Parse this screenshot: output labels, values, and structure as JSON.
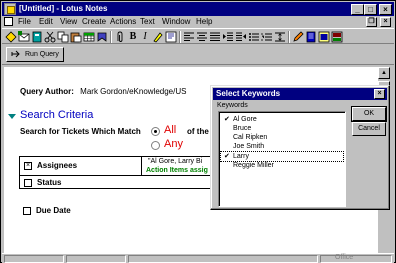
{
  "window": {
    "title": "[Untitled] - Lotus Notes",
    "min_glyph": "_",
    "max_glyph": "□",
    "close_glyph": "×"
  },
  "menu": {
    "items": [
      "File",
      "Edit",
      "View",
      "Create",
      "Actions",
      "Text",
      "Window",
      "Help"
    ],
    "restore_glyph": "❐",
    "close_glyph": "×"
  },
  "toolbar": {
    "bold": "B",
    "italic": "I"
  },
  "actions": {
    "run_query": "Run Query"
  },
  "query": {
    "author_label": "Query Author:",
    "author_value": "Mark Gordon/eKnowledge/US",
    "section_title": "Search Criteria",
    "match_label": "Search for Tickets Which Match",
    "option_all": "All",
    "option_any": "Any",
    "of_the": "of the",
    "selected_option": "All"
  },
  "criteria": {
    "assignees_label": "Assignees",
    "assignees_checked": "×",
    "assignees_value": "\"Al Gore, Larry Bi",
    "assignees_sub": "Action Items assig",
    "status_label": "Status",
    "due_date_label": "Due Date"
  },
  "dialog": {
    "title": "Select Keywords",
    "close_glyph": "×",
    "keywords_label": "Keywords",
    "ok_label": "OK",
    "cancel_label": "Cancel",
    "check_glyph": "✔",
    "items": [
      {
        "label": "Al Gore",
        "checked": true
      },
      {
        "label": "Bruce",
        "checked": false
      },
      {
        "label": "Cal Ripken",
        "checked": false
      },
      {
        "label": "Joe Smith",
        "checked": false
      },
      {
        "label": "Larry",
        "checked": true
      },
      {
        "label": "Reggie Miller",
        "checked": false
      }
    ]
  },
  "status": {
    "right_text": "Office"
  }
}
